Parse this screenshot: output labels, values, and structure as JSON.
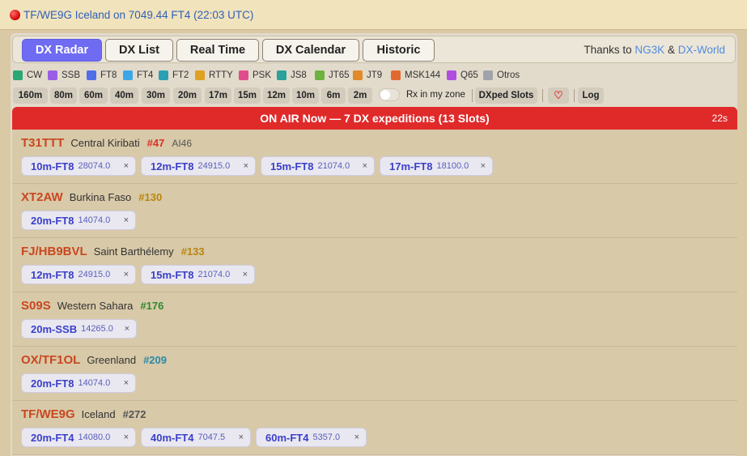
{
  "status": {
    "text": "TF/WE9G Iceland on 7049.44 FT4 (22:03 UTC)"
  },
  "tabs": [
    {
      "label": "DX Radar",
      "active": true
    },
    {
      "label": "DX List"
    },
    {
      "label": "Real Time"
    },
    {
      "label": "DX Calendar"
    },
    {
      "label": "Historic"
    }
  ],
  "thanks": {
    "prefix": "Thanks to",
    "link1": "NG3K",
    "amp": "&",
    "link2": "DX-World"
  },
  "modes": [
    {
      "label": "CW",
      "color": "#2aa775"
    },
    {
      "label": "SSB",
      "color": "#9b5de5"
    },
    {
      "label": "FT8",
      "color": "#4f6ee8"
    },
    {
      "label": "FT4",
      "color": "#3aa8e8"
    },
    {
      "label": "FT2",
      "color": "#2b9fb3"
    },
    {
      "label": "RTTY",
      "color": "#e0a020"
    },
    {
      "label": "PSK",
      "color": "#e04d8a"
    },
    {
      "label": "JS8",
      "color": "#2aa19a"
    },
    {
      "label": "JT65",
      "color": "#6cb33f"
    },
    {
      "label": "JT9",
      "color": "#e08a2a"
    },
    {
      "label": "MSK144",
      "color": "#e06a30"
    },
    {
      "label": "Q65",
      "color": "#b04ce0"
    },
    {
      "label": "Otros",
      "color": "#a0a4aa"
    }
  ],
  "bands": [
    "160m",
    "80m",
    "60m",
    "40m",
    "30m",
    "20m",
    "17m",
    "15m",
    "12m",
    "10m",
    "6m",
    "2m"
  ],
  "filters": {
    "rx_zone": "Rx in my zone",
    "dxped": "DXped Slots",
    "heart": "♡",
    "log": "Log"
  },
  "onair": {
    "title": "ON AIR Now — 7 DX expeditions (13 Slots)",
    "timer": "22s"
  },
  "expeditions": [
    {
      "call": "T31TTT",
      "country": "Central Kiribati",
      "rank": "#47",
      "rank_color": "#d8322b",
      "grid": "AI46",
      "slots": [
        {
          "band": "10m-FT8",
          "freq": "28074.0"
        },
        {
          "band": "12m-FT8",
          "freq": "24915.0"
        },
        {
          "band": "15m-FT8",
          "freq": "21074.0"
        },
        {
          "band": "17m-FT8",
          "freq": "18100.0"
        }
      ]
    },
    {
      "call": "XT2AW",
      "country": "Burkina Faso",
      "rank": "#130",
      "rank_color": "#b8860b",
      "grid": "",
      "slots": [
        {
          "band": "20m-FT8",
          "freq": "14074.0"
        }
      ]
    },
    {
      "call": "FJ/HB9BVL",
      "country": "Saint Barthélemy",
      "rank": "#133",
      "rank_color": "#b8860b",
      "grid": "",
      "slots": [
        {
          "band": "12m-FT8",
          "freq": "24915.0"
        },
        {
          "band": "15m-FT8",
          "freq": "21074.0"
        }
      ]
    },
    {
      "call": "S09S",
      "country": "Western Sahara",
      "rank": "#176",
      "rank_color": "#2f8a2f",
      "grid": "",
      "slots": [
        {
          "band": "20m-SSB",
          "freq": "14265.0"
        }
      ]
    },
    {
      "call": "OX/TF1OL",
      "country": "Greenland",
      "rank": "#209",
      "rank_color": "#2a8aa6",
      "grid": "",
      "slots": [
        {
          "band": "20m-FT8",
          "freq": "14074.0"
        }
      ]
    },
    {
      "call": "TF/WE9G",
      "country": "Iceland",
      "rank": "#272",
      "rank_color": "#555555",
      "grid": "",
      "slots": [
        {
          "band": "20m-FT4",
          "freq": "14080.0"
        },
        {
          "band": "40m-FT4",
          "freq": "7047.5"
        },
        {
          "band": "60m-FT4",
          "freq": "5357.0"
        }
      ]
    }
  ]
}
